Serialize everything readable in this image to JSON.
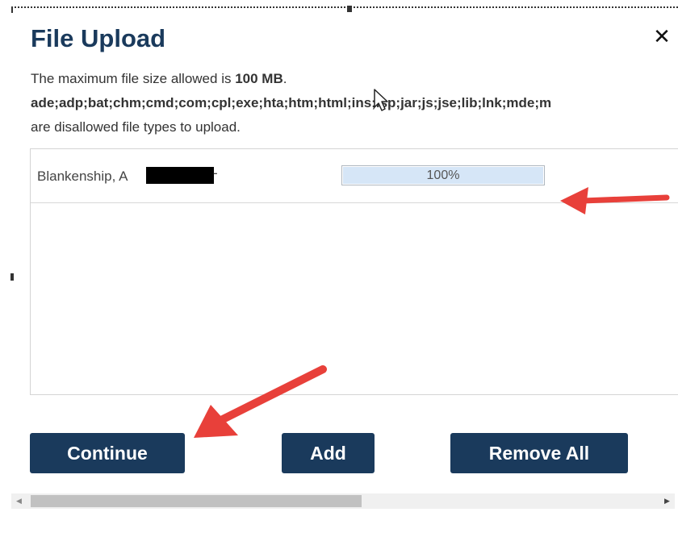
{
  "dialog": {
    "title": "File Upload",
    "close_glyph": "✕",
    "info_prefix": "The maximum file size allowed is ",
    "max_size": "100 MB",
    "info_suffix": ".",
    "disallowed_types": "ade;adp;bat;chm;cmd;com;cpl;exe;hta;htm;html;ins;isp;jar;js;jse;lib;lnk;mde;m",
    "disallowed_note": "are disallowed file types to upload."
  },
  "files": [
    {
      "name": "Blankenship, A",
      "name_suffix": "-",
      "progress_fraction": 1.0,
      "progress_label": "100%"
    }
  ],
  "buttons": {
    "continue_label": "Continue",
    "add_label": "Add",
    "remove_all_label": "Remove All"
  },
  "scrollbar": {
    "left_glyph": "◀",
    "right_glyph": "▶"
  },
  "colors": {
    "title": "#1a3a5c",
    "button_bg": "#1a3a5c",
    "button_text": "#ffffff",
    "progress_fill": "#d6e6f7",
    "annotation_arrow": "#e8403a"
  },
  "icons": {
    "close": "close-icon",
    "cursor": "mouse-pointer-icon"
  }
}
